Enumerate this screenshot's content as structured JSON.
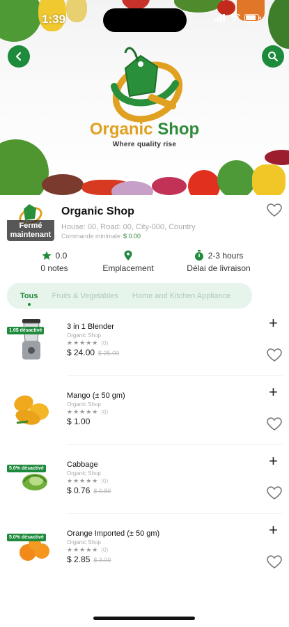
{
  "status_bar": {
    "time": "1:39"
  },
  "banner": {
    "brand_word1": "Organic",
    "brand_word2": "Shop",
    "tagline": "Where quality rise"
  },
  "shop": {
    "name": "Organic Shop",
    "closed_label_line1": "Fermé",
    "closed_label_line2": "maintenant",
    "address": "House: 00, Road: 00, City-000, Country",
    "min_order_label": "Commande minimale",
    "min_order_value": "$ 0.00",
    "rating_value": "0.0",
    "rating_label": "0 notes",
    "location_label": "Emplacement",
    "delivery_value": "2-3 hours",
    "delivery_label": "Délai de livraison"
  },
  "tabs": [
    {
      "label": "Tous",
      "active": true
    },
    {
      "label": "Fruits & Vegetables",
      "active": false
    },
    {
      "label": "Home and Kitchen Appliance",
      "active": false
    }
  ],
  "products": [
    {
      "name": "3 in 1 Blender",
      "shop": "Organic Shop",
      "stars": "★★★★★",
      "count": "(0)",
      "price": "$ 24.00",
      "old_price": "$ 25.00",
      "discount": "1.0$ désactivé",
      "image": "blender"
    },
    {
      "name": "Mango (± 50 gm)",
      "shop": "Organic Shop",
      "stars": "★★★★★",
      "count": "(0)",
      "price": "$ 1.00",
      "old_price": "",
      "discount": "",
      "image": "mango"
    },
    {
      "name": "Cabbage",
      "shop": "Organic Shop",
      "stars": "★★★★★",
      "count": "(0)",
      "price": "$ 0.76",
      "old_price": "$ 0.80",
      "discount": "5.0% désactivé",
      "image": "cabbage"
    },
    {
      "name": "Orange Imported (± 50 gm)",
      "shop": "Organic Shop",
      "stars": "★★★★★",
      "count": "(0)",
      "price": "$ 2.85",
      "old_price": "$ 3.00",
      "discount": "5.0% désactivé",
      "image": "orange"
    }
  ],
  "colors": {
    "brand_green": "#1e8a3c",
    "brand_yellow": "#e0a020",
    "tab_bg": "#e6f4ec"
  }
}
